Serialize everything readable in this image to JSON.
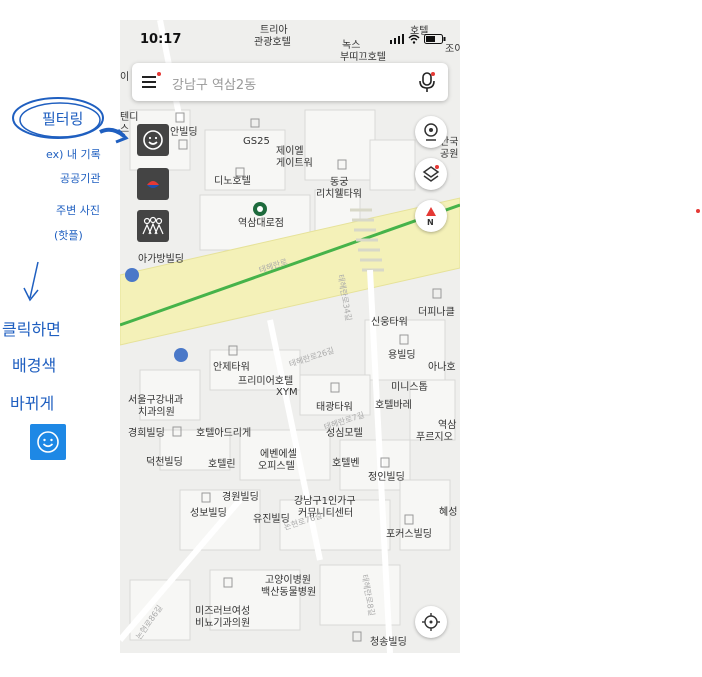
{
  "status_bar": {
    "time": "10:17"
  },
  "search": {
    "placeholder": "강남구 역삼2동"
  },
  "map_labels": [
    "트리아 관광호텔",
    "녹스",
    "부띠끄호텔",
    "GS25",
    "제이엘",
    "게이트워",
    "동궁",
    "리치웰타워",
    "디노호텔",
    "역삼대로점",
    "아가방빌딩",
    "신웅타워",
    "더피나클",
    "용빌딩",
    "아나호",
    "미니스톱",
    "안제타워",
    "프리미어호텔",
    "XYM",
    "태광타워",
    "호텔바레",
    "역삼",
    "푸르지오",
    "서울구강내과",
    "치과의원",
    "경희빌딩",
    "호텔아드리게",
    "성심모텔",
    "덕천빌딩",
    "호텔린",
    "에벤에셀",
    "오피스텔",
    "호텔벤",
    "정인빌딩",
    "경원빌딩",
    "강남구1인가구",
    "커뮤니티센터",
    "성보빌딩",
    "유진빌딩",
    "혜성",
    "포커스빌딩",
    "고양이병원",
    "백산동물병원",
    "미즈러브여성",
    "비뇨기과의원",
    "청송빌딩",
    "안빌딩",
    "안국",
    "공원",
    "조이",
    "호텔",
    "스"
  ],
  "road_labels": [
    "테헤란로",
    "테헤란로26길",
    "테헤란로34길",
    "논현로86길",
    "테헤란로8길",
    "논현로76길",
    "테헤란로7길"
  ],
  "annotations": {
    "filter_title": "필터링",
    "filter_example_1": "ex) 내 기록",
    "filter_example_2": "공공기관",
    "filter_example_3": "주변 사진",
    "filter_example_4": "(핫플)",
    "click_note_1": "클릭하면",
    "click_note_2": "배경색",
    "click_note_3": "바뀌게"
  },
  "colors": {
    "road_band": "#f4f1b8",
    "subway_line": "#46b34a",
    "annotation": "#1f5fc0",
    "button_dark": "#444444",
    "accent_red": "#e53935",
    "smile_bg": "#1e88e5"
  },
  "icons": [
    "hamburger-menu-icon",
    "mic-icon",
    "smile-icon",
    "flag-icon",
    "people-icon",
    "street-view-icon",
    "layers-icon",
    "compass-icon",
    "location-target-icon",
    "starbucks-icon",
    "bus-stop-icon"
  ]
}
